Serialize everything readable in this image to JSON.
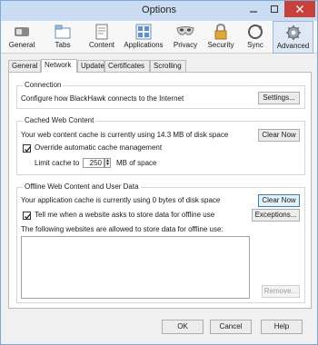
{
  "window": {
    "title": "Options"
  },
  "toolbar": {
    "items": [
      {
        "label": "General",
        "icon": "switch-icon"
      },
      {
        "label": "Tabs",
        "icon": "tabs-icon"
      },
      {
        "label": "Content",
        "icon": "content-page-icon"
      },
      {
        "label": "Applications",
        "icon": "applications-icon"
      },
      {
        "label": "Privacy",
        "icon": "mask-icon"
      },
      {
        "label": "Security",
        "icon": "padlock-icon"
      },
      {
        "label": "Sync",
        "icon": "sync-icon"
      },
      {
        "label": "Advanced",
        "icon": "gear-icon",
        "active": true
      }
    ]
  },
  "tabs": [
    {
      "label": "General"
    },
    {
      "label": "Network",
      "active": true
    },
    {
      "label": "Update"
    },
    {
      "label": "Certificates"
    },
    {
      "label": "Scrolling"
    }
  ],
  "connection": {
    "title": "Connection",
    "description": "Configure how BlackHawk connects to the Internet",
    "settings_label": "Settings..."
  },
  "cache": {
    "title": "Cached Web Content",
    "status": "Your web content cache is currently using 14.3 MB of disk space",
    "clear_label": "Clear Now",
    "override_label": "Override automatic cache management",
    "override_checked": true,
    "limit_label": "Limit cache to",
    "limit_value": "250",
    "limit_unit": "MB of space"
  },
  "offline": {
    "title": "Offline Web Content and User Data",
    "status": "Your application cache is currently using 0 bytes of disk space",
    "clear_label": "Clear Now",
    "tell_label": "Tell me when a website asks to store data for offline use",
    "tell_checked": true,
    "exceptions_label": "Exceptions...",
    "list_label": "The following websites are allowed to store data for offline use:",
    "remove_label": "Remove..."
  },
  "footer": {
    "ok_label": "OK",
    "cancel_label": "Cancel",
    "help_label": "Help"
  },
  "colors": {
    "accent": "#3c7fb1",
    "titlebar": "#c9dcf2",
    "close": "#c7403a"
  }
}
